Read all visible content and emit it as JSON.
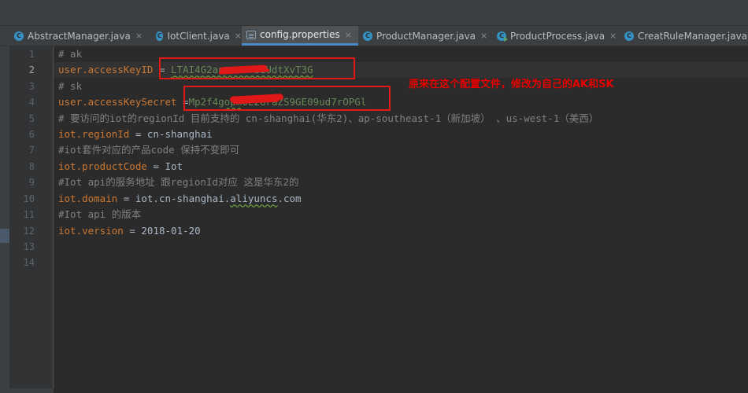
{
  "tabs": [
    {
      "label": "AbstractManager.java",
      "icon": "java-class-icon",
      "active": false
    },
    {
      "label": "IotClient.java",
      "icon": "java-class-icon",
      "active": false
    },
    {
      "label": "config.properties",
      "icon": "properties-file-icon",
      "active": true
    },
    {
      "label": "ProductManager.java",
      "icon": "java-class-icon",
      "active": false
    },
    {
      "label": "ProductProcess.java",
      "icon": "java-runnable-class-icon",
      "active": false
    },
    {
      "label": "CreatRuleManager.java",
      "icon": "java-class-icon",
      "active": false
    }
  ],
  "tab_close_glyph": "×",
  "gutter": {
    "line_numbers": [
      "1",
      "2",
      "3",
      "4",
      "5",
      "6",
      "7",
      "8",
      "9",
      "10",
      "11",
      "12",
      "13",
      "14"
    ],
    "current_line": "2"
  },
  "code": {
    "l1": "# ak",
    "l2_key": "user.accessKeyID",
    "l2_op": " = ",
    "l2_val": "LTAI4G2anvrearz1UdtXvT3G",
    "l3": "# sk",
    "l4_key": "user.accessKeySecret",
    "l4_op": " =",
    "l4_val_a": "Mp2f4g",
    "l4_val_b": "opm",
    "l4_val_c": "0L2GraZS9GE09ud7rOPGl",
    "l5": "# 要访问的iot的regionId 目前支持的 cn-shanghai(华东2)、ap-southeast-1（新加坡） 、us-west-1（美西）",
    "l6_key": "iot.regionId",
    "l6_op": " = ",
    "l6_val": "cn-shanghai",
    "l7": "#iot套件对应的产品code 保持不变即可",
    "l8_key": "iot.productCode",
    "l8_op": " = ",
    "l8_val": "Iot",
    "l9": "#Iot api的服务地址 跟regionId对应 这是华东2的",
    "l10_key": "iot.domain",
    "l10_op": " = ",
    "l10_val_a": "iot.cn-shanghai.",
    "l10_val_b": "aliyuncs",
    "l10_val_c": ".com",
    "l11": "#Iot api 的版本",
    "l12_key": "iot.version",
    "l12_op": " = ",
    "l12_val": "2018-01-20"
  },
  "annotation": "原来在这个配置文件，修改为自己的AK和SK",
  "colors": {
    "annotation_red": "#e60000",
    "editor_bg": "#2b2b2b",
    "key_orange": "#cc7832",
    "comment_gray": "#808080"
  }
}
